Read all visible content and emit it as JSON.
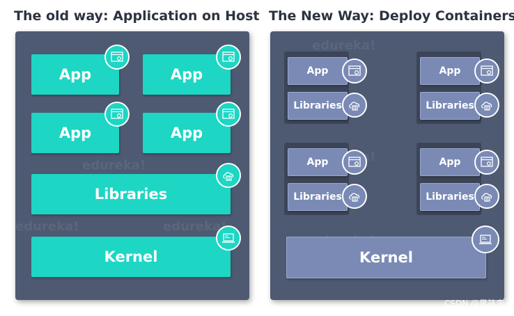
{
  "left": {
    "title": "The old way: Application on Host",
    "apps": [
      "App",
      "App",
      "App",
      "App"
    ],
    "libraries": "Libraries",
    "kernel": "Kernel",
    "watermark": "edureka!"
  },
  "right": {
    "title": "The New Way: Deploy Containers",
    "containers": [
      {
        "app": "App",
        "libraries": "Libraries"
      },
      {
        "app": "App",
        "libraries": "Libraries"
      },
      {
        "app": "App",
        "libraries": "Libraries"
      },
      {
        "app": "App",
        "libraries": "Libraries"
      }
    ],
    "kernel": "Kernel",
    "watermark": "edureka!"
  },
  "credit": "CSDN @男孩李",
  "colors": {
    "panel": "#4e5a72",
    "teal": "#1dd6c4",
    "blue": "#7a8ab5",
    "container": "#3c4558",
    "title": "#2d3340"
  },
  "icons": {
    "app": "app-window-gear-icon",
    "libraries": "cloud-library-icon",
    "kernel": "laptop-terminal-icon"
  }
}
